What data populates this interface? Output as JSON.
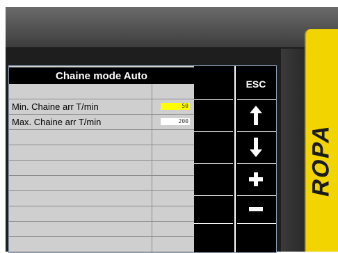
{
  "panel": {
    "title": "Chaine mode Auto",
    "rows": [
      {
        "label": "",
        "value": ""
      },
      {
        "label": "Min. Chaine arr T/min",
        "value": "50",
        "highlight": "#ffff00"
      },
      {
        "label": "Max. Chaine arr T/min",
        "value": "200",
        "highlight": "#ffffff"
      },
      {
        "label": "",
        "value": ""
      },
      {
        "label": "",
        "value": ""
      },
      {
        "label": "",
        "value": ""
      },
      {
        "label": "",
        "value": ""
      },
      {
        "label": "",
        "value": ""
      },
      {
        "label": "",
        "value": ""
      },
      {
        "label": "",
        "value": ""
      },
      {
        "label": "",
        "value": ""
      }
    ]
  },
  "softkeys": {
    "esc_label": "ESC",
    "icons": [
      "arrow-up-icon",
      "arrow-down-icon",
      "plus-icon",
      "minus-icon"
    ]
  },
  "brand": {
    "name": "ROPA",
    "color": "#f2d400"
  }
}
